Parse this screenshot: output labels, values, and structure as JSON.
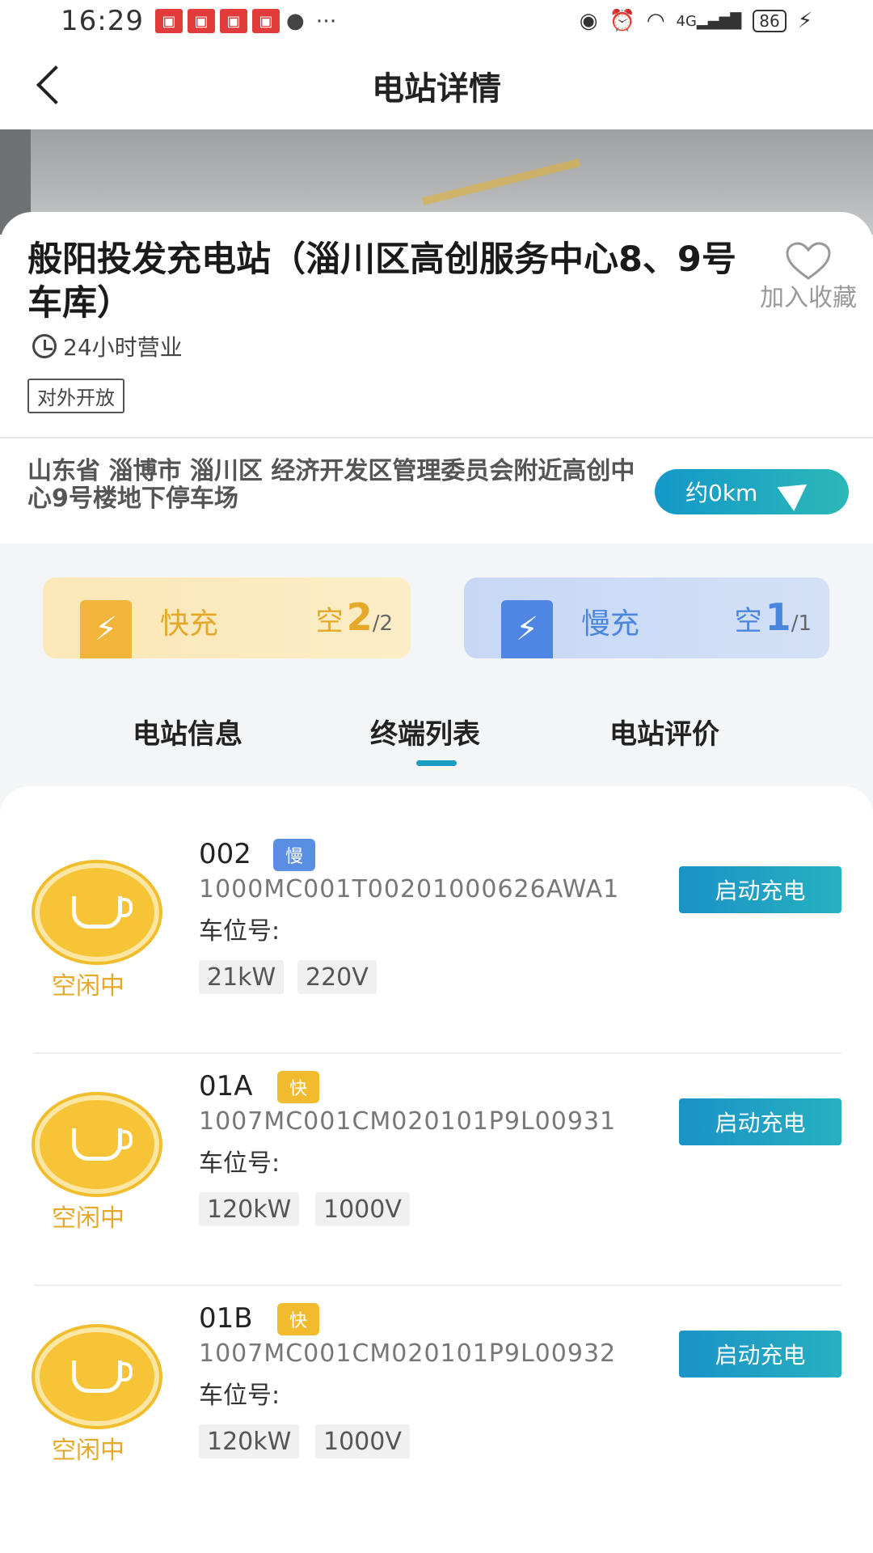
{
  "status_bar": {
    "time": "16:29",
    "network": "4G",
    "battery": "86"
  },
  "header": {
    "title": "电站详情"
  },
  "station": {
    "name": "般阳投发充电站（淄川区高创服务中心8、9号车库）",
    "favorite_label": "加入收藏",
    "hours": "24小时营业",
    "open_tag": "对外开放",
    "address": "山东省 淄博市 淄川区 经济开发区管理委员会附近高创中心9号楼地下停车场",
    "distance": "约0km"
  },
  "charging_summary": {
    "fast": {
      "label": "快充",
      "free_prefix": "空",
      "free": "2",
      "total": "/2"
    },
    "slow": {
      "label": "慢充",
      "free_prefix": "空",
      "free": "1",
      "total": "/1"
    }
  },
  "tabs": [
    {
      "label": "电站信息"
    },
    {
      "label": "终端列表",
      "active": true
    },
    {
      "label": "电站评价"
    }
  ],
  "terminals": [
    {
      "name": "002",
      "speed": "慢",
      "code": "1000MC001T00201000626AWA1",
      "slot_label": "车位号:",
      "status": "空闲中",
      "power": "21kW",
      "voltage": "220V",
      "action": "启动充电"
    },
    {
      "name": "01A",
      "speed": "快",
      "code": "1007MC001CM020101P9L00931",
      "slot_label": "车位号:",
      "status": "空闲中",
      "power": "120kW",
      "voltage": "1000V",
      "action": "启动充电"
    },
    {
      "name": "01B",
      "speed": "快",
      "code": "1007MC001CM020101P9L00932",
      "slot_label": "车位号:",
      "status": "空闲中",
      "power": "120kW",
      "voltage": "1000V",
      "action": "启动充电"
    }
  ],
  "colors": {
    "accent": "#1a9cc0",
    "fast": "#f2bb2e",
    "slow": "#5a8ee2"
  }
}
